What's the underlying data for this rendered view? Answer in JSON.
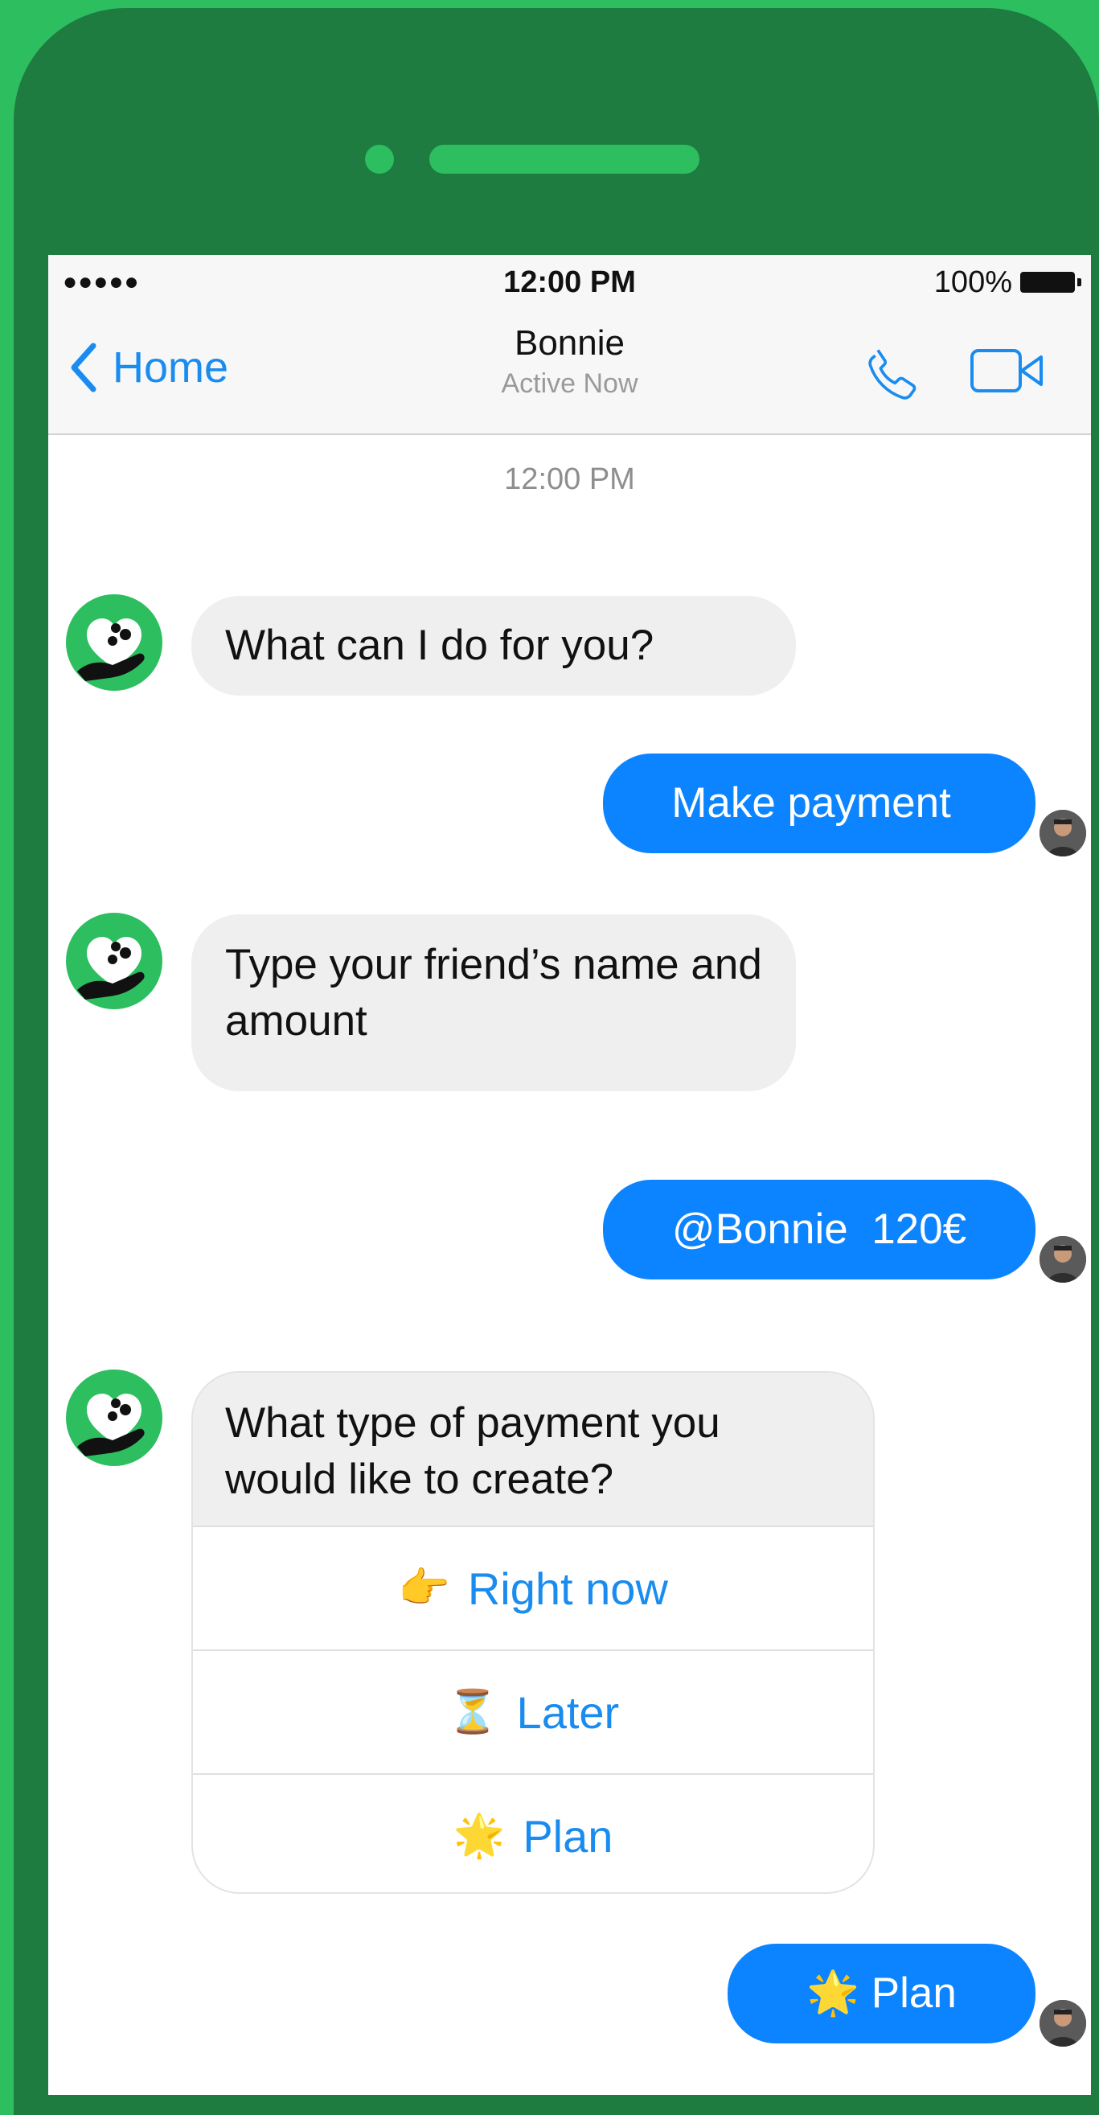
{
  "status_bar": {
    "signal": "●●●●●",
    "time": "12:00 PM",
    "battery": "100%"
  },
  "header": {
    "back_label": "Home",
    "contact_name": "Bonnie",
    "contact_status": "Active Now",
    "call_icon": "phone-icon",
    "video_icon": "video-camera-icon"
  },
  "conversation": {
    "timestamp": "12:00 PM",
    "messages": [
      {
        "from": "bot",
        "text": "What can I do for you?"
      },
      {
        "from": "user",
        "text": "Make payment"
      },
      {
        "from": "bot",
        "text": "Type your friend’s name and amount"
      },
      {
        "from": "user",
        "text": "@Bonnie  120€"
      },
      {
        "from": "bot",
        "text": "What type of payment you would like to create?"
      },
      {
        "from": "user",
        "text": "🌟 Plan"
      }
    ],
    "quick_replies": [
      {
        "emoji": "👉",
        "label": "Right now"
      },
      {
        "emoji": "⏳",
        "label": "Later"
      },
      {
        "emoji": "🌟",
        "label": "Plan"
      }
    ]
  },
  "colors": {
    "background": "#2dbe60",
    "phone_body": "#1e7c41",
    "accent_blue": "#0c84ff",
    "bubble_gray": "#efefef"
  }
}
